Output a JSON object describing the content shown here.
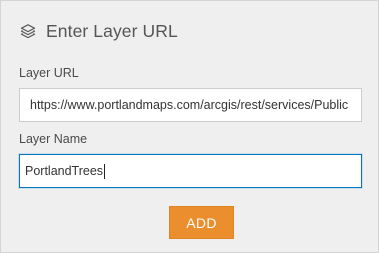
{
  "header": {
    "title": "Enter Layer URL",
    "icon": "layers-icon"
  },
  "form": {
    "url_label": "Layer URL",
    "url_value": "https://www.portlandmaps.com/arcgis/rest/services/Public",
    "name_label": "Layer Name",
    "name_value": "PortlandTrees"
  },
  "actions": {
    "add_label": "ADD"
  },
  "colors": {
    "accent": "#ea8e2e",
    "focus": "#0079c1",
    "panel": "#efefef"
  }
}
